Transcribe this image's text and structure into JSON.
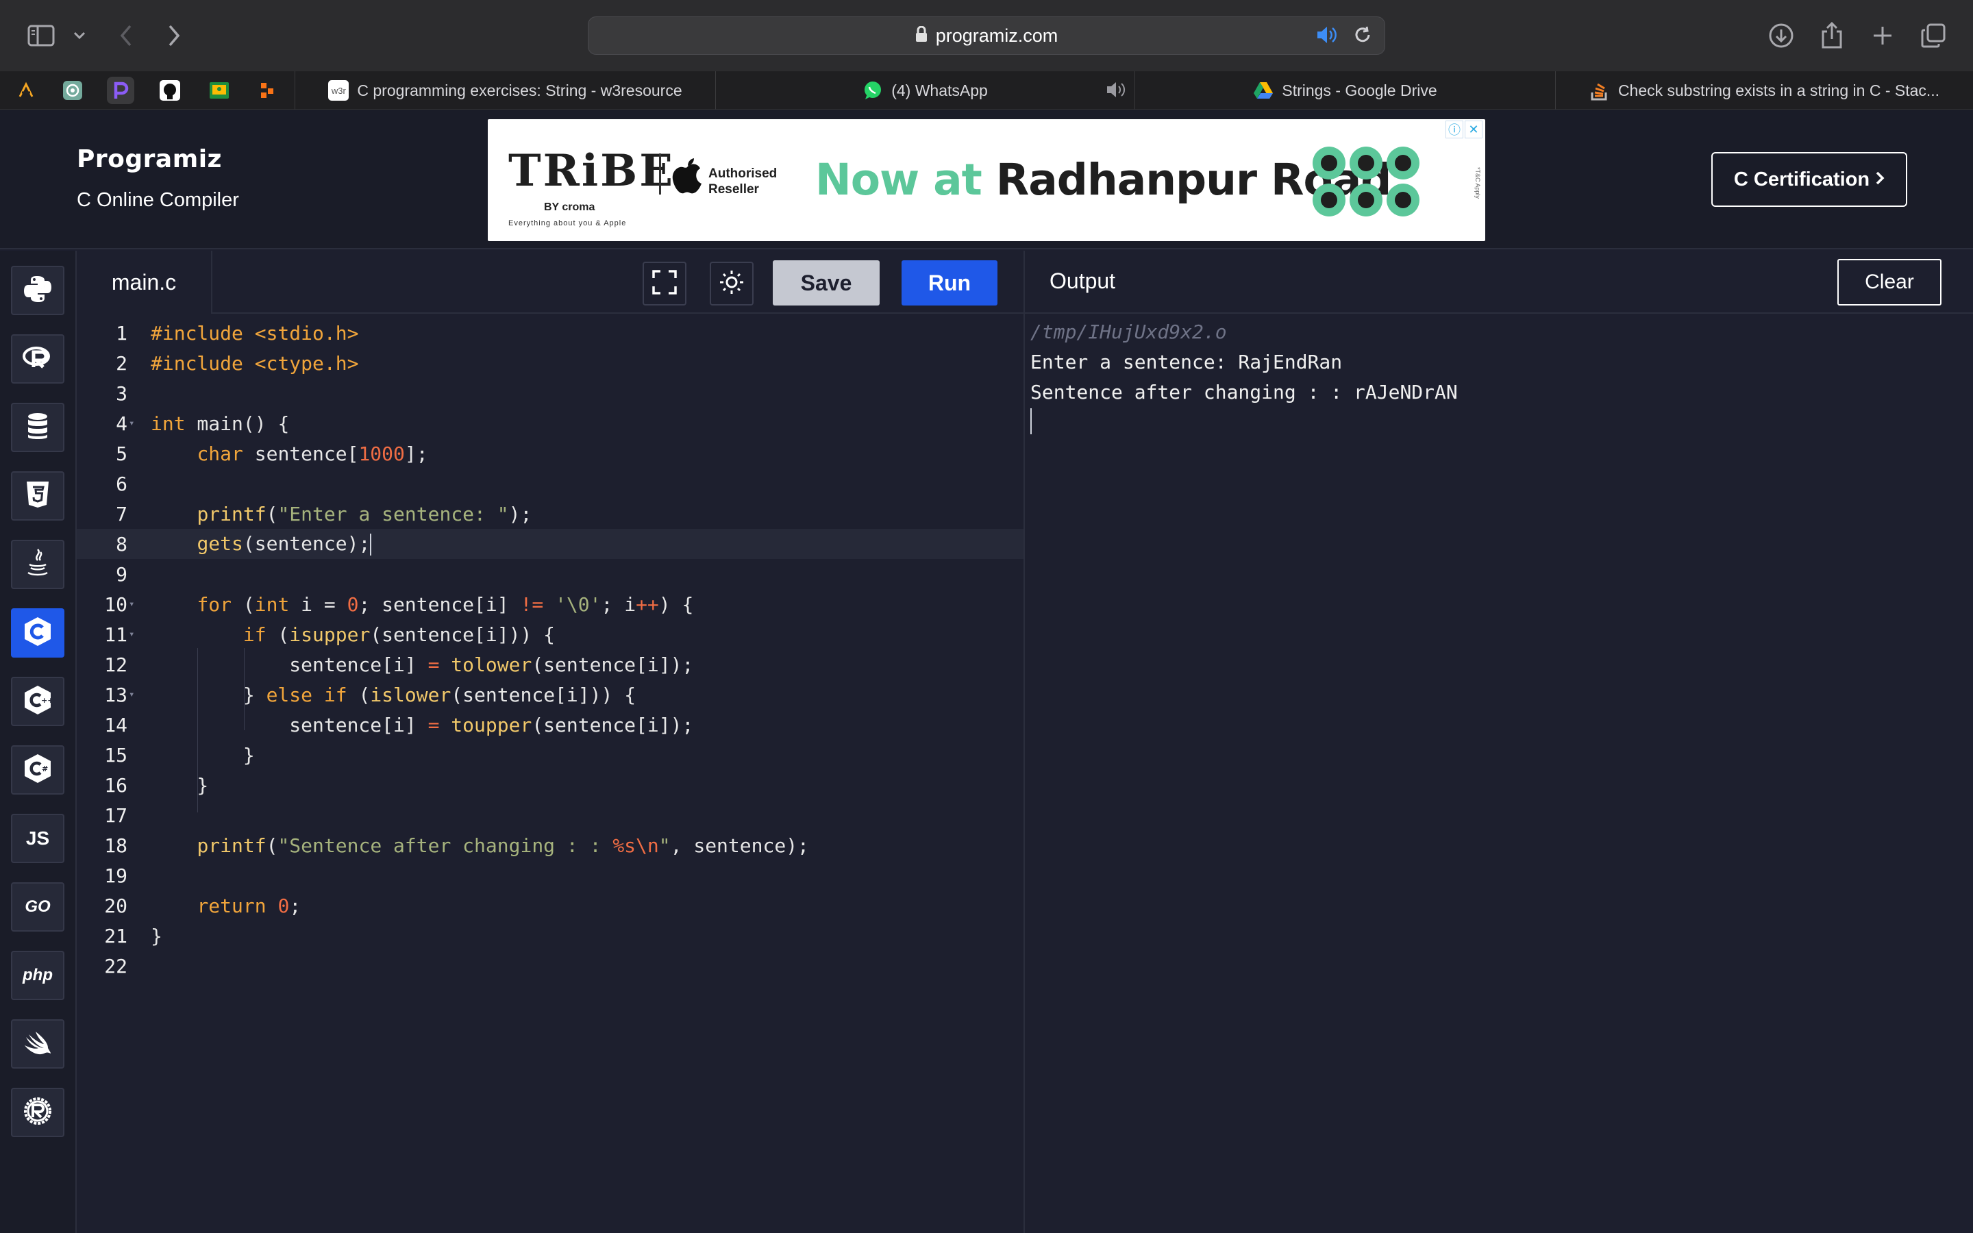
{
  "browser": {
    "url": "programiz.com",
    "tabs": [
      {
        "label": "C programming exercises: String - w3resource",
        "favicon": "w3r"
      },
      {
        "label": "(4) WhatsApp"
      },
      {
        "label": "Strings - Google Drive"
      },
      {
        "label": "Check substring exists in a string in C - Stac..."
      }
    ]
  },
  "header": {
    "logo": "Programiz",
    "subtitle": "C Online Compiler",
    "cert_button": "C Certification",
    "ad": {
      "brand": "TRiBE",
      "by": "BY croma",
      "tagline": "Everything about you & Apple",
      "reseller": "Authorised Reseller",
      "headline_accent": "Now at",
      "headline_main": "Radhanpur Road",
      "fine_print": "*T&C Apply"
    }
  },
  "languages": [
    {
      "label": "",
      "icon": "python-icon"
    },
    {
      "label": "",
      "icon": "r-icon"
    },
    {
      "label": "",
      "icon": "sql-icon"
    },
    {
      "label": "",
      "icon": "html5-icon"
    },
    {
      "label": "",
      "icon": "java-icon"
    },
    {
      "label": "",
      "icon": "c-icon",
      "active": true
    },
    {
      "label": "",
      "icon": "cpp-icon"
    },
    {
      "label": "",
      "icon": "csharp-icon"
    },
    {
      "label": "JS",
      "icon": "javascript-icon"
    },
    {
      "label": "GO",
      "icon": "go-icon"
    },
    {
      "label": "php",
      "icon": "php-icon"
    },
    {
      "label": "",
      "icon": "swift-icon"
    },
    {
      "label": "",
      "icon": "rust-icon"
    }
  ],
  "editor": {
    "filename": "main.c",
    "save_label": "Save",
    "run_label": "Run",
    "line_numbers": [
      "1",
      "2",
      "3",
      "4",
      "5",
      "6",
      "7",
      "8",
      "9",
      "10",
      "11",
      "12",
      "13",
      "14",
      "15",
      "16",
      "17",
      "18",
      "19",
      "20",
      "21",
      "22"
    ]
  },
  "output": {
    "title": "Output",
    "clear_label": "Clear",
    "lines": [
      "/tmp/IHujUxd9x2.o",
      "Enter a sentence: RajEndRan",
      "Sentence after changing : : rAJeNDrAN"
    ]
  },
  "colors": {
    "accent": "#1f58e8",
    "background": "#1d1f2e",
    "keyword": "#f1a53b",
    "string": "#a6b37d",
    "number": "#f06d44"
  }
}
